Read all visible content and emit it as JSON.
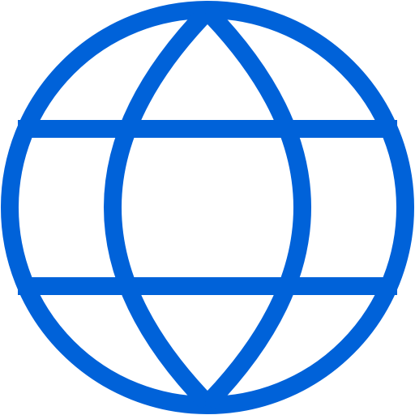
{
  "icon": {
    "name": "globe-icon",
    "stroke_color": "#0062D9",
    "background_color": "#FFFFFF"
  }
}
